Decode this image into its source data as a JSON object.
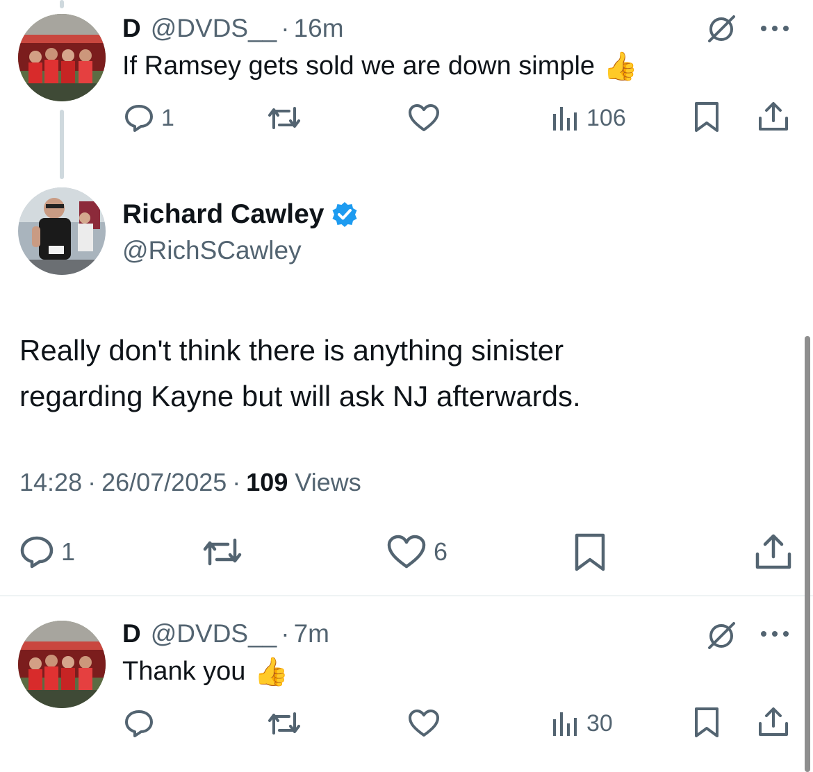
{
  "reply1": {
    "name": "D",
    "handle": "@DVDS__",
    "time": "16m",
    "text": "If Ramsey gets sold we are down simple",
    "emoji": "👍",
    "replies": "1",
    "views": "106"
  },
  "main": {
    "name": "Richard Cawley",
    "handle": "@RichSCawley",
    "text_line1": "Really don't think there is anything sinister",
    "text_line2": "regarding Kayne but will ask NJ afterwards.",
    "time": "14:28",
    "date": "26/07/2025",
    "views_count": "109",
    "views_label": "Views",
    "replies": "1",
    "likes": "6"
  },
  "reply2": {
    "name": "D",
    "handle": "@DVDS__",
    "time": "7m",
    "text": "Thank you",
    "emoji": "👍",
    "views": "30"
  },
  "colors": {
    "text": "#0f1419",
    "muted": "#536471",
    "verified": "#1d9bf0",
    "divider": "#eff3f4",
    "thread_line": "#cfd9de"
  }
}
